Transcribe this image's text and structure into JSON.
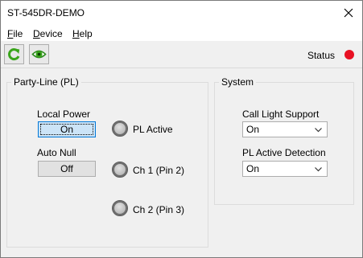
{
  "window": {
    "title": "ST-545DR-DEMO"
  },
  "menu": [
    {
      "mnemonic": "F",
      "rest": "ile"
    },
    {
      "mnemonic": "D",
      "rest": "evice"
    },
    {
      "mnemonic": "H",
      "rest": "elp"
    }
  ],
  "toolbar": {
    "refresh_icon": "refresh-icon",
    "view_icon": "eye-icon",
    "status_label": "Status",
    "status_color": "#e81123"
  },
  "party_line": {
    "title": "Party-Line (PL)",
    "local_power_label": "Local Power",
    "local_power_value": "On",
    "auto_null_label": "Auto Null",
    "auto_null_value": "Off",
    "indicators": [
      "PL Active",
      "Ch 1 (Pin 2)",
      "Ch 2 (Pin 3)"
    ]
  },
  "system": {
    "title": "System",
    "call_light_label": "Call Light Support",
    "call_light_value": "On",
    "pl_active_detection_label": "PL Active Detection",
    "pl_active_detection_value": "On"
  }
}
